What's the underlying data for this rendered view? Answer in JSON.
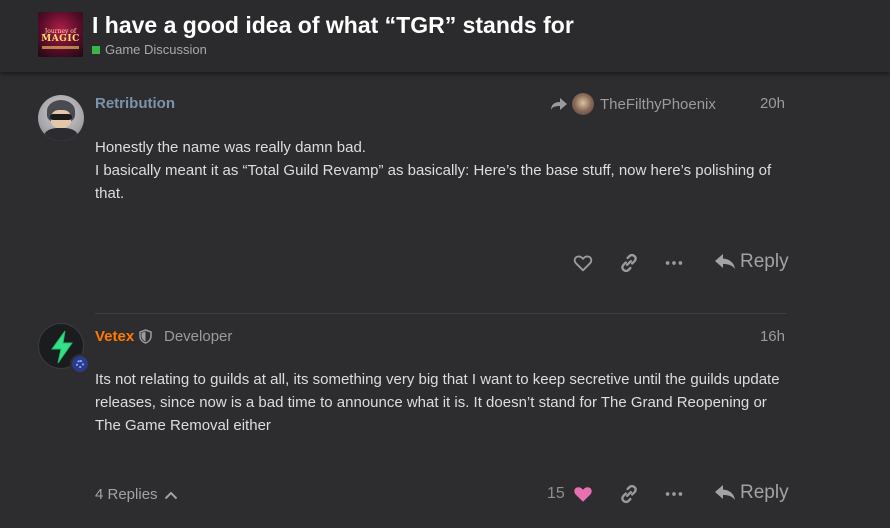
{
  "topic": {
    "title": "I have a good idea of what “TGR” stands for",
    "category": "Game Discussion",
    "category_color": "#3ab54a",
    "logo_text": [
      "Journey of",
      "MAGIC"
    ]
  },
  "posts": [
    {
      "username": "Retribution",
      "username_color": "#7b93ab",
      "reply_to": "TheFilthyPhoenix",
      "timestamp": "20h",
      "body": [
        "Honestly the name was really damn bad.",
        "I basically meant it as “Total Guild Revamp” as basically: Here’s the base stuff, now here’s polishing of that."
      ],
      "actions": {
        "reply_label": "Reply"
      }
    },
    {
      "username": "Vetex",
      "username_color": "#ff7a00",
      "user_title": "Developer",
      "timestamp": "16h",
      "body": [
        "Its not relating to guilds at all, its something very big that I want to keep secretive until the guilds update releases, since now is a bad time to announce what it is. It doesn’t stand for The Grand Reopening or The Game Removal either"
      ],
      "actions": {
        "replies_label": "4 Replies",
        "like_count": "15",
        "like_color": "#e86fb3",
        "reply_label": "Reply"
      }
    }
  ]
}
